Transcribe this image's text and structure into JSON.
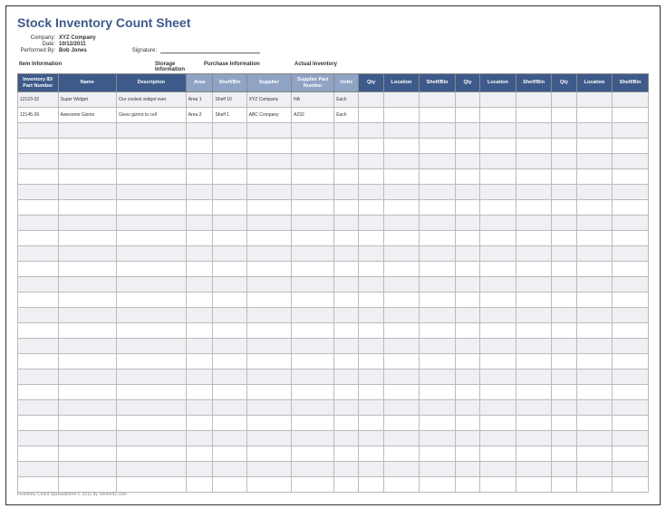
{
  "title": "Stock Inventory Count Sheet",
  "meta": {
    "companyLabel": "Company:",
    "companyValue": "XYZ Company",
    "dateLabel": "Date:",
    "dateValue": "10/12/2011",
    "performedByLabel": "Performed By:",
    "performedByValue": "Bob Jones",
    "signatureLabel": "Signature:"
  },
  "groups": {
    "item": "Item Information",
    "storage": "Storage Information",
    "purchase": "Purchase Information",
    "actual": "Actual Inventory"
  },
  "columns": {
    "inventoryId": "Inventory ID/\nPart Number",
    "name": "Name",
    "description": "Description",
    "area": "Area",
    "shelfBin": "Shelf/Bin",
    "supplier": "Supplier",
    "supplierPart": "Supplier Part\nNumber",
    "units": "Units",
    "qty": "Qty",
    "location": "Location",
    "shelfBin2": "Shelf/Bin"
  },
  "rows": [
    {
      "id": "12123-32",
      "name": "Super Widget",
      "desc": "Our coolest widget ever",
      "area": "Area 1",
      "shelf": "Shelf 10",
      "supplier": "XYZ Company",
      "spn": "NA",
      "units": "Each"
    },
    {
      "id": "12145-39",
      "name": "Awesome Gizmo",
      "desc": "Gives gizmo to cell",
      "area": "Area 2",
      "shelf": "Shelf 1",
      "supplier": "ABC Company",
      "spn": "A232",
      "units": "Each"
    }
  ],
  "emptyRowCount": 24,
  "footer": "Inventory Count Spreadsheet © 2011 by Vertex42.com"
}
